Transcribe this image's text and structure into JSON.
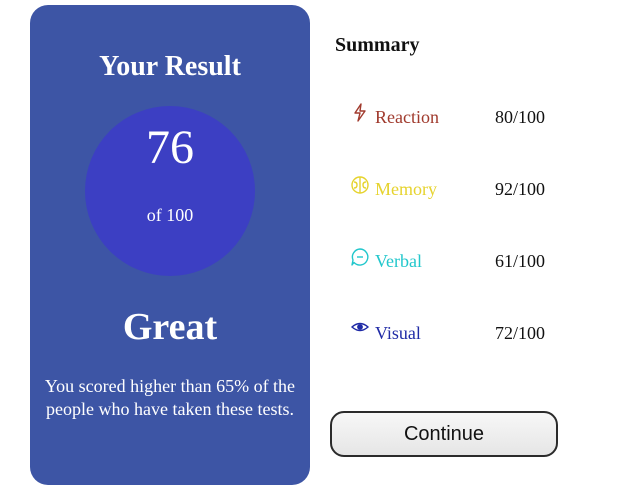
{
  "result": {
    "title": "Your Result",
    "score": "76",
    "total": "of 100",
    "rating": "Great",
    "description": "You scored higher than 65% of the people who have taken these tests."
  },
  "summary": {
    "title": "Summary",
    "items": [
      {
        "label": "Reaction",
        "score": "80/100",
        "icon": "lightning-icon",
        "color": "#a03a2d"
      },
      {
        "label": "Memory",
        "score": "92/100",
        "icon": "brain-icon",
        "color": "#e6d32e"
      },
      {
        "label": "Verbal",
        "score": "61/100",
        "icon": "chat-bubble-icon",
        "color": "#22c7cc"
      },
      {
        "label": "Visual",
        "score": "72/100",
        "icon": "eye-icon",
        "color": "#1f2aa6"
      }
    ]
  },
  "actions": {
    "continue_label": "Continue"
  },
  "colors": {
    "card_background": "#3d55a5",
    "circle_background": "#3c3fc3",
    "text_light": "#ffffff"
  }
}
